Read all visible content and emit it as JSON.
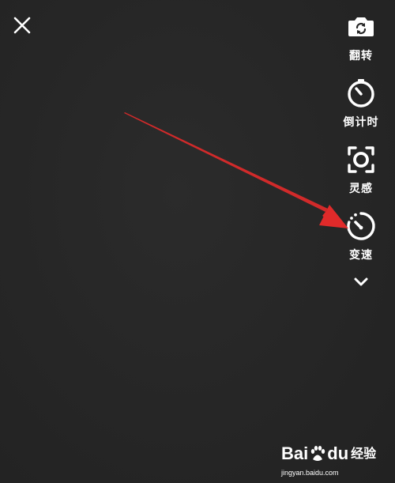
{
  "toolbar": {
    "items": [
      {
        "label": "翻转",
        "icon": "flip-camera-icon"
      },
      {
        "label": "倒计时",
        "icon": "countdown-timer-icon"
      },
      {
        "label": "灵感",
        "icon": "inspiration-lens-icon"
      },
      {
        "label": "变速",
        "icon": "speed-gauge-icon"
      }
    ],
    "more_icon": "chevron-down-icon"
  },
  "close_icon": "close-icon",
  "annotation": {
    "color": "#e02a2a"
  },
  "watermark": {
    "logo_left": "Bai",
    "logo_right": "du",
    "logo_suffix": "经验",
    "url": "jingyan.baidu.com"
  }
}
